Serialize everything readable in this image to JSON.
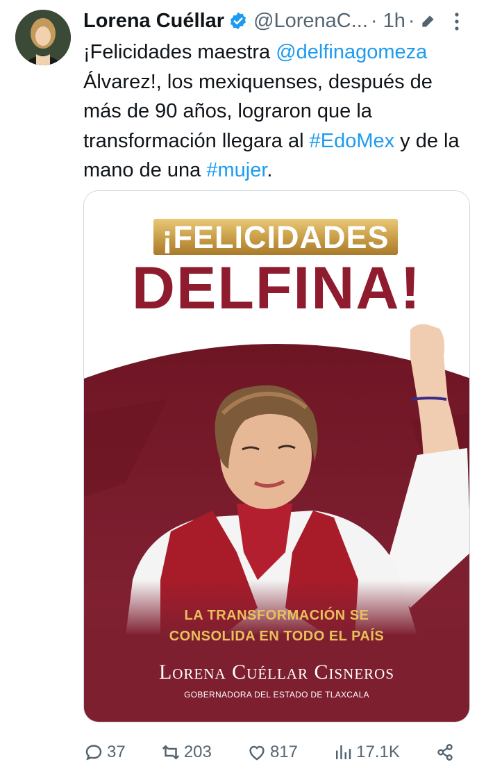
{
  "author": {
    "name": "Lorena Cuéllar",
    "handle": "@LorenaC...",
    "time": "1h",
    "separator": "·"
  },
  "tweet": {
    "parts": [
      {
        "text": "¡Felicidades maestra ",
        "type": "text"
      },
      {
        "text": "@delfinagomeza",
        "type": "mention"
      },
      {
        "text": " Álvarez!, los mexiquenses, después de más de 90 años, lograron que la transformación llegara al ",
        "type": "text"
      },
      {
        "text": "#EdoMex",
        "type": "hashtag"
      },
      {
        "text": " y de la mano de una ",
        "type": "text"
      },
      {
        "text": "#mujer",
        "type": "hashtag"
      },
      {
        "text": ".",
        "type": "text"
      }
    ]
  },
  "media": {
    "headline_small": "¡FELICIDADES",
    "headline_big": "DELFINA!",
    "slogan_line1": "LA TRANSFORMACIÓN SE",
    "slogan_line2": "CONSOLIDA EN TODO EL PAÍS",
    "signer": "Lorena Cuéllar Cisneros",
    "signer_title": "GOBERNADORA DEL ESTADO DE TLAXCALA"
  },
  "actions": {
    "replies": "37",
    "retweets": "203",
    "likes": "817",
    "views": "17.1K"
  },
  "colors": {
    "link": "#1d9bf0",
    "muted": "#536471",
    "maroon": "#7a1d2b",
    "gold": "#c79c45"
  },
  "icons": [
    "verified-badge-icon",
    "edit-icon",
    "more-icon",
    "reply-icon",
    "retweet-icon",
    "like-icon",
    "views-icon",
    "share-icon"
  ]
}
